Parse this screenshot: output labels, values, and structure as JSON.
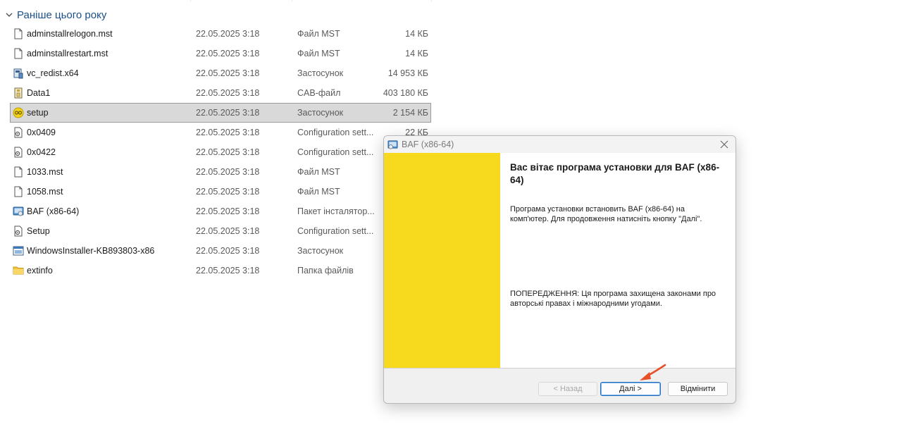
{
  "group": {
    "label": "Раніше цього року"
  },
  "files": [
    {
      "name": "adminstallrelogon.mst",
      "date": "22.05.2025 3:18",
      "type": "Файл MST",
      "size": "14 КБ",
      "icon": "document-icon"
    },
    {
      "name": "adminstallrestart.mst",
      "date": "22.05.2025 3:18",
      "type": "Файл MST",
      "size": "14 КБ",
      "icon": "document-icon"
    },
    {
      "name": "vc_redist.x64",
      "date": "22.05.2025 3:18",
      "type": "Застосунок",
      "size": "14 953 КБ",
      "icon": "installer-exe-icon"
    },
    {
      "name": "Data1",
      "date": "22.05.2025 3:18",
      "type": "CAB-файл",
      "size": "403 180 КБ",
      "icon": "cab-archive-icon"
    },
    {
      "name": "setup",
      "date": "22.05.2025 3:18",
      "type": "Застосунок",
      "size": "2 154 КБ",
      "icon": "setup-app-icon",
      "selected": true
    },
    {
      "name": "0x0409",
      "date": "22.05.2025 3:18",
      "type": "Configuration sett...",
      "size": "22 КБ",
      "icon": "config-file-icon"
    },
    {
      "name": "0x0422",
      "date": "22.05.2025 3:18",
      "type": "Configuration sett...",
      "size": "",
      "icon": "config-file-icon"
    },
    {
      "name": "1033.mst",
      "date": "22.05.2025 3:18",
      "type": "Файл MST",
      "size": "",
      "icon": "document-icon"
    },
    {
      "name": "1058.mst",
      "date": "22.05.2025 3:18",
      "type": "Файл MST",
      "size": "",
      "icon": "document-icon"
    },
    {
      "name": "BAF (x86-64)",
      "date": "22.05.2025 3:18",
      "type": "Пакет інсталятор...",
      "size": "",
      "icon": "msi-package-icon"
    },
    {
      "name": "Setup",
      "date": "22.05.2025 3:18",
      "type": "Configuration sett...",
      "size": "",
      "icon": "config-file-icon"
    },
    {
      "name": "WindowsInstaller-KB893803-x86",
      "date": "22.05.2025 3:18",
      "type": "Застосунок",
      "size": "",
      "icon": "window-app-icon"
    },
    {
      "name": "extinfo",
      "date": "22.05.2025 3:18",
      "type": "Папка файлів",
      "size": "",
      "icon": "folder-icon"
    }
  ],
  "dialog": {
    "title": "BAF (x86-64)",
    "heading": "Вас вітає програма установки для BAF (x86-64)",
    "body": "Програма установки встановить BAF (x86-64) на комп'ютер. Для продовження натисніть кнопку \"Далі\".",
    "warning": "ПОПЕРЕДЖЕННЯ: Ця програма захищена законами про авторські правах і міжнародними угодами.",
    "buttons": {
      "back": "< Назад",
      "next": "Далі >",
      "cancel": "Відмінити"
    },
    "banner_color": "#f7da1e"
  },
  "colors": {
    "accent": "#1e6fbf",
    "annotation_arrow": "#e8502a"
  }
}
